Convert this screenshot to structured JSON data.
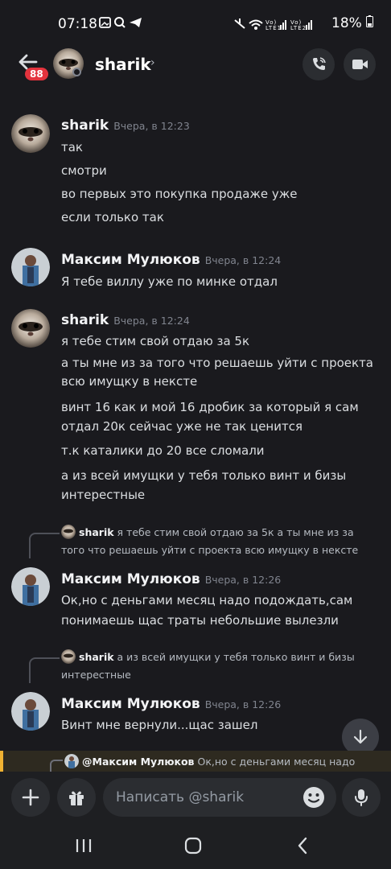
{
  "status_bar": {
    "time": "07:18",
    "network_labels": "Vo) LTE1 ıl Vo) LTE2 ıl",
    "battery": "18%"
  },
  "header": {
    "unread_badge": "88",
    "channel_name": "sharik",
    "chevron": "›",
    "icons": [
      "back-arrow-icon",
      "phone-call-icon",
      "video-call-icon"
    ]
  },
  "messages": [
    {
      "author": "sharik",
      "time": "Вчера, в 12:23",
      "lines": [
        "так",
        "смотри",
        "во первых это покупка продаже уже",
        "если только так"
      ]
    },
    {
      "author": "Максим Мулюков",
      "time": "Вчера, в 12:24",
      "lines": [
        "Я тебе виллу уже по минке отдал"
      ]
    },
    {
      "author": "sharik",
      "time": "Вчера, в 12:24",
      "lines": [
        "я тебе стим свой отдаю за 5к",
        "а ты мне из за того что решаешь уйти с проекта",
        "всю имущку в нексте",
        "винт 16 как и мой 16 дробик за который я сам",
        "отдал 20к сейчас уже не так ценится",
        "т.к каталики до 20 все сломали",
        "а из всей имущки у тебя только винт и бизы",
        "интерестные"
      ]
    },
    {
      "reply_to": {
        "author": "sharik",
        "lines": [
          "я тебе стим свой отдаю за 5к а ты мне из за",
          "того что решаешь уйти с проекта всю имущку в нексте"
        ]
      },
      "author": "Максим Мулюков",
      "time": "Вчера, в 12:26",
      "lines": [
        "Ок,но с деньгами месяц надо подождать,сам",
        "понимаешь щас траты небольшие вылезли"
      ]
    },
    {
      "reply_to": {
        "author": "sharik",
        "lines": [
          "а из всей имущки у тебя только винт и бизы",
          "интерестные"
        ]
      },
      "author": "Максим Мулюков",
      "time": "Вчера, в 12:26",
      "lines": [
        "Винт мне вернули...щас зашел"
      ]
    }
  ],
  "replying_bar": {
    "mention": "@Максим Мулюков",
    "preview": "Ок,но с деньгами месяц надо"
  },
  "composer": {
    "placeholder": "Написать @sharik",
    "icons": [
      "plus-icon",
      "gift-icon",
      "emoji-icon",
      "microphone-icon"
    ]
  },
  "nav": {
    "icons": [
      "recent-apps-icon",
      "home-icon",
      "back-icon"
    ]
  },
  "colors": {
    "background": "#1a1a1e",
    "badge": "#e3333d",
    "reply_accent": "#f0b232",
    "text": "#dbdee1",
    "muted": "#80848e"
  }
}
